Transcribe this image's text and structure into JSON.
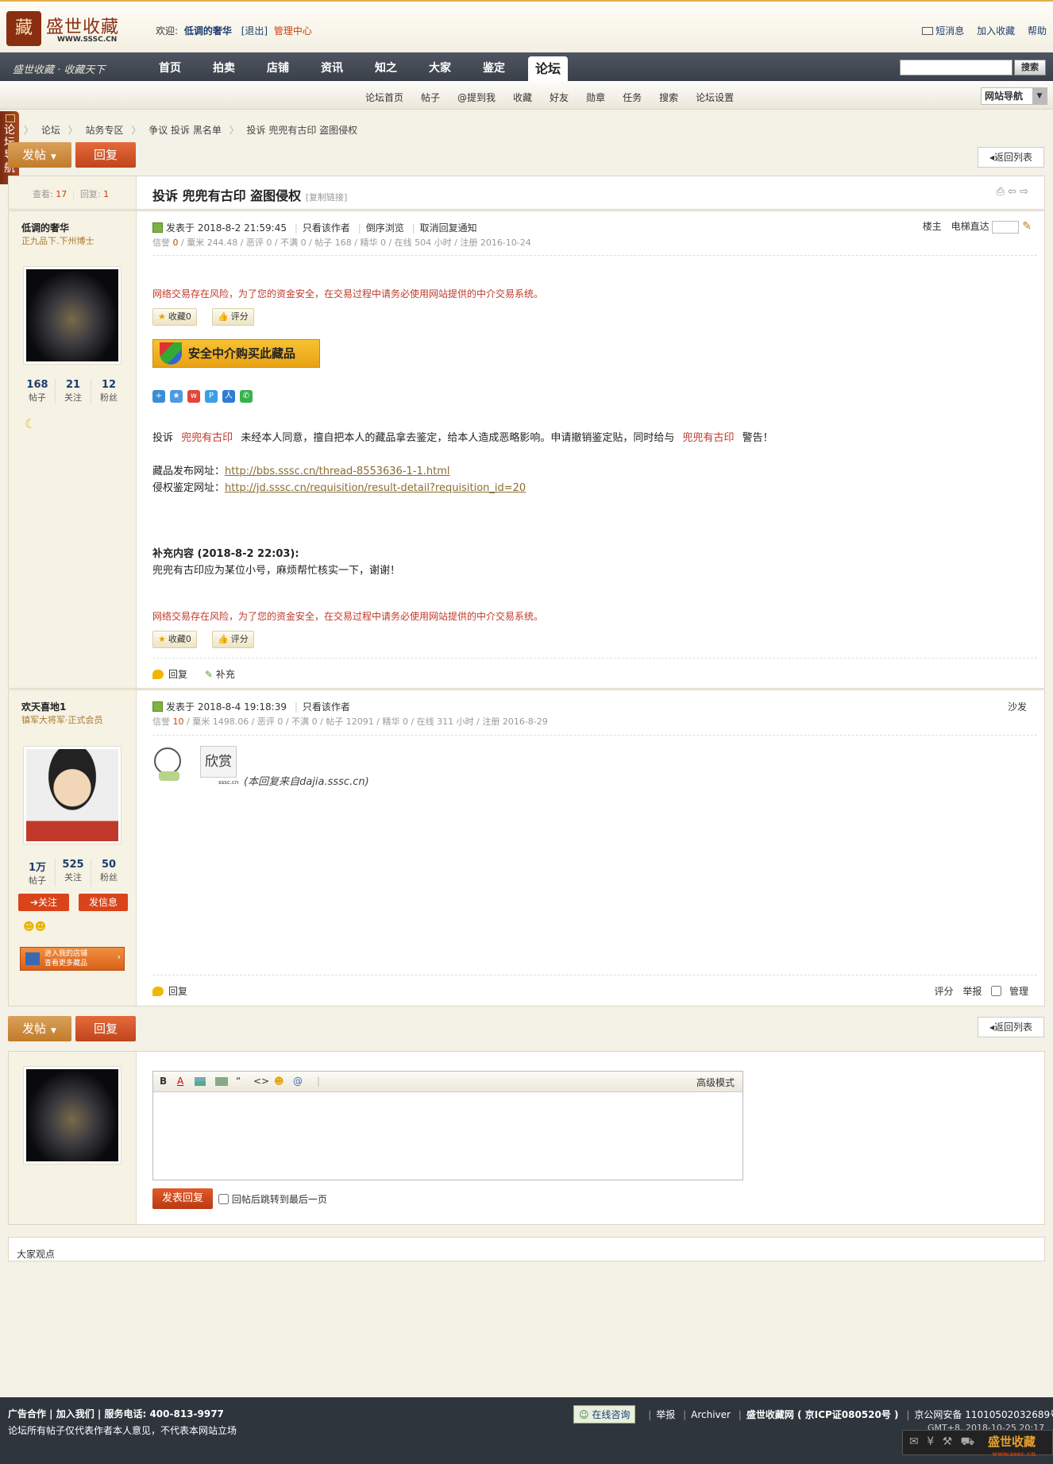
{
  "header": {
    "logo_name": "盛世收藏",
    "logo_url": "WWW.SSSC.CN",
    "logo_seal": "藏",
    "welcome_label": "欢迎:",
    "username": "低调的奢华",
    "logout": "[退出]",
    "admin": "管理中心",
    "top_links": [
      "短消息",
      "加入收藏",
      "帮助"
    ]
  },
  "nav": {
    "slogan": "盛世收藏 · 收藏天下",
    "items": [
      "首页",
      "拍卖",
      "店铺",
      "资讯",
      "知之",
      "大家",
      "鉴定",
      "论坛"
    ],
    "active": "论坛",
    "search_button": "搜索",
    "search_placeholder": ""
  },
  "subnav": {
    "items": [
      "论坛首页",
      "帖子",
      "@提到我",
      "收藏",
      "好友",
      "勋章",
      "任务",
      "搜索",
      "论坛设置"
    ],
    "site_nav": "网站导航"
  },
  "side_tab": "论坛导航",
  "breadcrumb": [
    "论坛",
    "站务专区",
    "争议 投诉 黑名单",
    "投诉 兜兜有古印 盗图侵权"
  ],
  "buttons": {
    "post": "发帖",
    "reply": "回复",
    "back": "返回列表"
  },
  "thread": {
    "views_label": "查看:",
    "views": "17",
    "replies_label": "回复:",
    "replies": "1",
    "title": "投诉 兜兜有古印 盗图侵权",
    "copy_link": "[复制链接]"
  },
  "post1": {
    "author": "低调的奢华",
    "rank": "正九品下.下州博士",
    "stats": [
      {
        "num": "168",
        "label": "帖子"
      },
      {
        "num": "21",
        "label": "关注"
      },
      {
        "num": "12",
        "label": "粉丝"
      }
    ],
    "meta": {
      "posted": "发表于 2018-8-2 21:59:45",
      "only_author": "只看该作者",
      "reverse": "倒序浏览",
      "cancel_notify": "取消回复通知",
      "floor": "楼主",
      "elevator": "电梯直达"
    },
    "stats_line": {
      "credit_label": "信誉",
      "credit": "0",
      "rest": "/ 粟米 244.48 / 恶评 0 / 不满 0 / 帖子 168 / 精华 0 / 在线 504 小时 / 注册 2016-10-24"
    },
    "warning": "网络交易存在风险，为了您的资金安全，在交易过程中请务必使用网站提供的中介交易系统。",
    "fav_btn": "收藏0",
    "rate_btn": "评分",
    "secure_btn": "安全中介购买此藏品",
    "body": {
      "p1_a": "投诉",
      "p1_b": "兜兜有古印",
      "p1_c": "未经本人同意，擅自把本人的藏品拿去鉴定，给本人造成恶略影响。申请撤销鉴定贴，同时给与",
      "p1_d": "兜兜有古印",
      "p1_e": "警告！",
      "l1_label": "藏品发布网址：",
      "l1_url": "http://bbs.sssc.cn/thread-8553636-1-1.html",
      "l2_label": "侵权鉴定网址：",
      "l2_url": "http://jd.sssc.cn/requisition/result-detail?requisition_id=20",
      "supp_title": "补充内容 (2018-8-2 22:03):",
      "supp_text": "兜兜有古印应为某位小号，麻烦帮忙核实一下，谢谢！"
    },
    "actions": [
      "回复",
      "补充"
    ]
  },
  "post2": {
    "author": "欢天喜地1",
    "rank": "镇军大将军·正式会员",
    "stats": [
      {
        "num": "1万",
        "label": "帖子"
      },
      {
        "num": "525",
        "label": "关注"
      },
      {
        "num": "50",
        "label": "粉丝"
      }
    ],
    "follow": "➔关注",
    "message": "发信息",
    "shop_banner": [
      "进入我的店铺",
      "查看更多藏品"
    ],
    "meta": {
      "posted": "发表于 2018-8-4 19:18:39",
      "only_author": "只看该作者",
      "floor": "沙发"
    },
    "stats_line": {
      "credit_label": "信誉",
      "credit": "10",
      "rest": "/ 粟米 1498.06 / 恶评 0 / 不满 0 / 帖子 12091 / 精华 0 / 在线 311 小时 / 注册 2016-8-29"
    },
    "sticker_text": "欣赏",
    "sticker_sub": "sssc.cn",
    "source": "(本回复来自dajia.sssc.cn)",
    "reply": "回复",
    "right_actions": [
      "评分",
      "举报",
      "管理"
    ]
  },
  "editor": {
    "toolbar": [
      "B",
      "A",
      "“",
      "<>",
      "@"
    ],
    "advanced": "高级模式",
    "submit": "发表回复",
    "jump_label": "回帖后跳转到最后一页"
  },
  "opinions": "大家观点",
  "footer": {
    "line1": "广告合作 | 加入我们 | 服务电话: 400-813-9977",
    "line2": "论坛所有帖子仅代表作者本人意见，不代表本网站立场",
    "consult": "在线咨询",
    "links": [
      "举报",
      "Archiver",
      "盛世收藏网 ( 京ICP证080520号 )",
      "京公网安备 11010502032689号"
    ],
    "gmt": "GMT+8, 2018-10-25 20:17",
    "float_logo": "盛世收藏",
    "float_url": "www.sssc.cn"
  },
  "colors": {
    "accent_red": "#c1441b",
    "accent_gold": "#c27b2a",
    "warning_red": "#c0392b",
    "nav_dark": "#3a4049"
  }
}
